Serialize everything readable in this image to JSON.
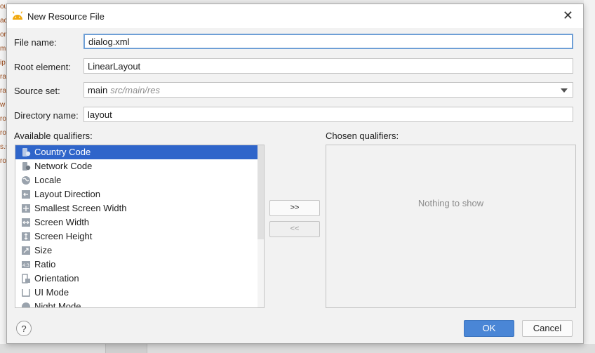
{
  "background": {
    "left_fragments": [
      "out",
      "ac",
      "m",
      "om",
      "ip",
      "ra",
      "ra",
      "w",
      "ro",
      "ro",
      "s.s",
      "ro"
    ]
  },
  "dialog": {
    "title": "New Resource File",
    "icon": "android-icon",
    "file_name": {
      "label": "File name:",
      "value": "dialog.xml"
    },
    "root_element": {
      "label": "Root element:",
      "value": "LinearLayout"
    },
    "source_set": {
      "label": "Source set:",
      "value": "main",
      "hint": "src/main/res"
    },
    "directory_name": {
      "label": "Directory name:",
      "value": "layout"
    },
    "available_label": "Available qualifiers:",
    "chosen_label": "Chosen qualifiers:",
    "qualifiers": [
      {
        "label": "Country Code",
        "icon": "country-code-icon",
        "selected": true
      },
      {
        "label": "Network Code",
        "icon": "network-code-icon"
      },
      {
        "label": "Locale",
        "icon": "globe-icon"
      },
      {
        "label": "Layout Direction",
        "icon": "layout-direction-icon"
      },
      {
        "label": "Smallest Screen Width",
        "icon": "smallest-width-icon"
      },
      {
        "label": "Screen Width",
        "icon": "screen-width-icon"
      },
      {
        "label": "Screen Height",
        "icon": "screen-height-icon"
      },
      {
        "label": "Size",
        "icon": "size-icon"
      },
      {
        "label": "Ratio",
        "icon": "ratio-icon"
      },
      {
        "label": "Orientation",
        "icon": "orientation-icon"
      },
      {
        "label": "UI Mode",
        "icon": "ui-mode-icon"
      },
      {
        "label": "Night Mode",
        "icon": "night-mode-icon"
      }
    ],
    "add_button": ">>",
    "remove_button": "<<",
    "empty_text": "Nothing to show",
    "help": "?",
    "ok": "OK",
    "cancel": "Cancel"
  },
  "colors": {
    "selection": "#2f65ca",
    "ok_button": "#4a86d6",
    "focus_border": "#6e9fd6"
  }
}
